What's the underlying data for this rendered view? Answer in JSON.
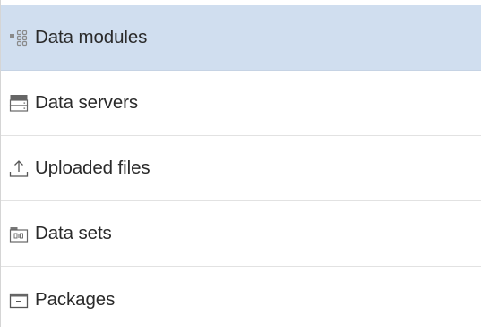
{
  "nav": {
    "items": [
      {
        "label": "Data modules",
        "icon": "data-modules-icon",
        "selected": true
      },
      {
        "label": "Data servers",
        "icon": "data-servers-icon",
        "selected": false
      },
      {
        "label": "Uploaded files",
        "icon": "upload-icon",
        "selected": false
      },
      {
        "label": "Data sets",
        "icon": "data-sets-icon",
        "selected": false
      },
      {
        "label": "Packages",
        "icon": "packages-icon",
        "selected": false
      }
    ]
  },
  "colors": {
    "selected_background": "#d0deef",
    "text": "#2a2a2a",
    "icon": "#555555",
    "divider": "#e2e2e2"
  }
}
